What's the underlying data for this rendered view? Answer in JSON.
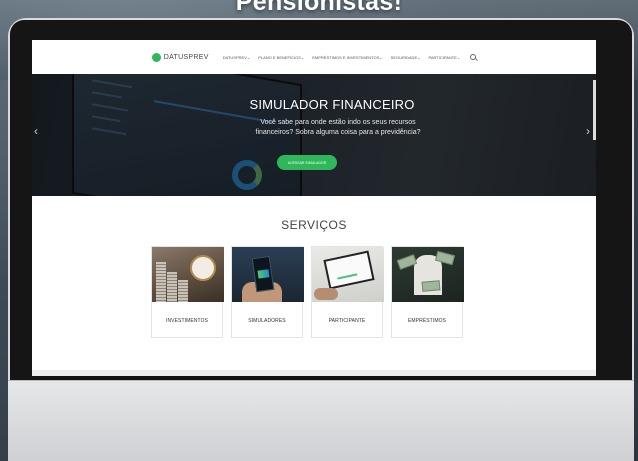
{
  "headline": "Pensionistas!",
  "nav": {
    "logo_text": "DATUSPREV",
    "items": [
      "DATUSPREV",
      "PLANO E BENEFÍCIOS",
      "EMPRÉSTIMOS E INVESTIMENTOS",
      "SEGURIDADE",
      "PARTICIPANTE"
    ]
  },
  "hero": {
    "title": "SIMULADOR FINANCEIRO",
    "text_line1": "Você sabe para onde estão indo os seus recursos",
    "text_line2": "financeiros? Sobra alguma coisa para a previdência?",
    "button_label": "ACESSAR SIMULADOR"
  },
  "services": {
    "title": "SERVIÇOS",
    "cards": [
      {
        "label": "INVESTIMENTOS",
        "icon": "coins-clock-image"
      },
      {
        "label": "SIMULADORES",
        "icon": "phone-image"
      },
      {
        "label": "PARTICIPANTE",
        "icon": "laptop-image"
      },
      {
        "label": "EMPRÉSTIMOS",
        "icon": "money-image"
      }
    ]
  },
  "colors": {
    "accent": "#2fb85a",
    "hero_bg": "#28333d"
  }
}
